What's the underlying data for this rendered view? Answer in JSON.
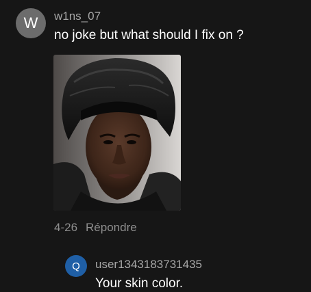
{
  "comment": {
    "avatar_letter": "W",
    "username": "w1ns_07",
    "text": "no joke but what should I fix on ?",
    "date": "4-26",
    "reply_label": "Répondre"
  },
  "reply": {
    "avatar_letter": "Q",
    "username": "user1343183731435",
    "text": "Your skin color."
  },
  "colors": {
    "background": "#161616",
    "avatar_main": "#6c6c6c",
    "avatar_reply": "#1f5fa6",
    "secondary_text": "#a6a6a6",
    "meta_text": "#8e8e8e"
  }
}
